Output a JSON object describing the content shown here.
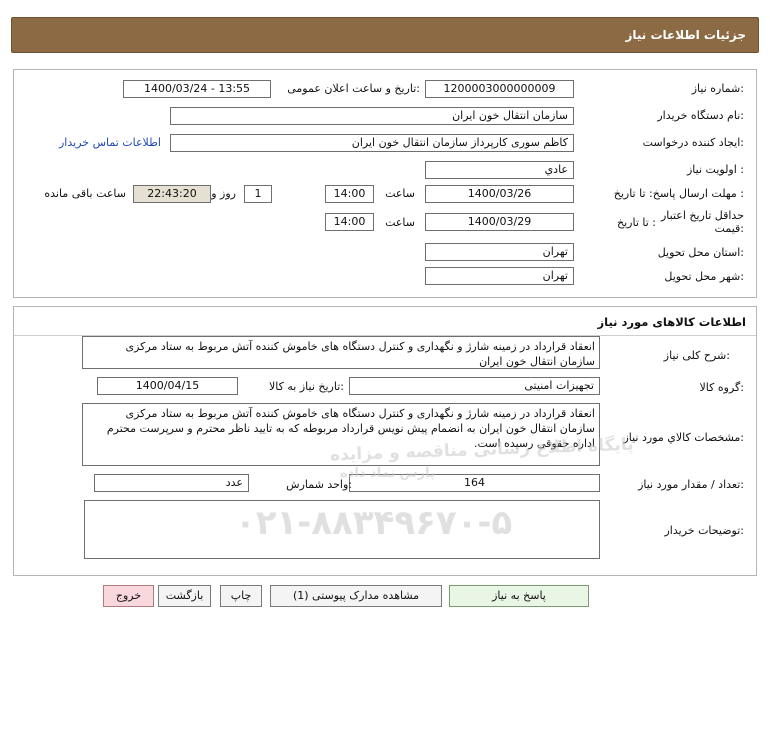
{
  "header": {
    "title": "جزئیات اطلاعات نیاز"
  },
  "details": {
    "need_number_label": "شماره نیاز:",
    "need_number": "1200003000000009",
    "announce_label": "تاریخ و ساعت اعلان عمومی:",
    "announce_value": "1400/03/24 - 13:55",
    "buyer_org_label": "نام دستگاه خریدار:",
    "buyer_org": "سازمان انتقال خون ایران",
    "requester_label": "ایجاد کننده درخواست:",
    "requester": "کاظم  سوری کارپرداز سازمان انتقال خون ایران",
    "contact_link": "اطلاعات تماس خریدار",
    "priority_label": "اولویت نیاز :",
    "priority": "عادي",
    "deadline_label": "مهلت ارسال پاسخ:  تا تاریخ :",
    "deadline_date": "1400/03/26",
    "time_label": "ساعت",
    "deadline_time": "14:00",
    "days_value": "1",
    "days_label": "روز و",
    "remaining_time": "22:43:20",
    "remaining_label": "ساعت باقی مانده",
    "validity_label_1": "حداقل تاریخ اعتبار",
    "validity_label_2": "قیمت:",
    "validity_until": "تا تاریخ :",
    "validity_date": "1400/03/29",
    "validity_time": "14:00",
    "province_label": "استان محل تحویل:",
    "province": "تهران",
    "city_label": "شهر محل تحویل:",
    "city": "تهران"
  },
  "goods": {
    "title": "اطلاعات کالاهای مورد نیاز",
    "desc_label": "شرح کلی نیاز:",
    "desc": "انعقاد قرارداد در زمینه شارژ و نگهداری و کنترل دستگاه های خاموش کننده آتش مربوط به ستاد مرکزی سازمان انتقال خون ایران",
    "group_label": "گروه کالا:",
    "group": "تجهیزات امنیتی",
    "need_date_label": "تاریخ نیاز به کالا:",
    "need_date": "1400/04/15",
    "spec_label": "مشخصات کالاي مورد نیاز:",
    "spec": "انعقاد قرارداد در زمینه شارژ و نگهداری و کنترل دستگاه های خاموش کننده آتش مربوط به ستاد مرکزی سازمان انتقال خون ایران به انضمام پیش نویس قرارداد مربوطه که به تایید ناظر محترم و سرپرست محترم اداره حقوقی رسیده است.",
    "qty_label": "تعداد / مقدار مورد نیاز:",
    "qty": "164",
    "unit_label": "واحد شمارش:",
    "unit": "عدد",
    "buyer_notes_label": "توضیحات خریدار:",
    "buyer_notes": ""
  },
  "buttons": {
    "reply": "پاسخ به نیاز",
    "attachments": "مشاهده مدارک پیوستی (1)",
    "print": "چاپ",
    "back": "بازگشت",
    "exit": "خروج"
  },
  "watermark": {
    "line1": "پایگاه اطلاع رسانی مناقصه و مزایده",
    "line2": "۰۲۱-۸۸۳۴۹۶۷۰-۵",
    "line3": "پارس نماد داده"
  },
  "colors": {
    "header_bg": "#8c6a44",
    "link": "#1f49b6",
    "exit_bg": "#f8d8dc",
    "reply_bg": "#e9f6e6",
    "remaining_bg": "#e6e0d2"
  }
}
